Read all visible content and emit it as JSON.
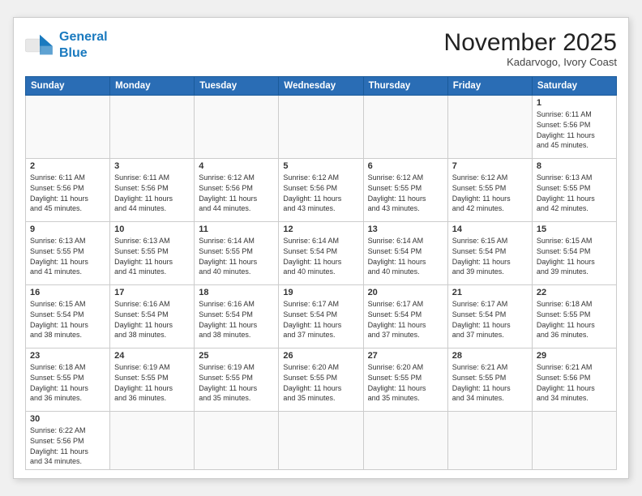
{
  "header": {
    "logo_line1": "General",
    "logo_line2": "Blue",
    "month_title": "November 2025",
    "location": "Kadarvogo, Ivory Coast"
  },
  "weekdays": [
    "Sunday",
    "Monday",
    "Tuesday",
    "Wednesday",
    "Thursday",
    "Friday",
    "Saturday"
  ],
  "days": [
    {
      "number": "",
      "info": ""
    },
    {
      "number": "",
      "info": ""
    },
    {
      "number": "",
      "info": ""
    },
    {
      "number": "",
      "info": ""
    },
    {
      "number": "",
      "info": ""
    },
    {
      "number": "",
      "info": ""
    },
    {
      "number": "1",
      "info": "Sunrise: 6:11 AM\nSunset: 5:56 PM\nDaylight: 11 hours\nand 45 minutes."
    },
    {
      "number": "2",
      "info": "Sunrise: 6:11 AM\nSunset: 5:56 PM\nDaylight: 11 hours\nand 45 minutes."
    },
    {
      "number": "3",
      "info": "Sunrise: 6:11 AM\nSunset: 5:56 PM\nDaylight: 11 hours\nand 44 minutes."
    },
    {
      "number": "4",
      "info": "Sunrise: 6:12 AM\nSunset: 5:56 PM\nDaylight: 11 hours\nand 44 minutes."
    },
    {
      "number": "5",
      "info": "Sunrise: 6:12 AM\nSunset: 5:56 PM\nDaylight: 11 hours\nand 43 minutes."
    },
    {
      "number": "6",
      "info": "Sunrise: 6:12 AM\nSunset: 5:55 PM\nDaylight: 11 hours\nand 43 minutes."
    },
    {
      "number": "7",
      "info": "Sunrise: 6:12 AM\nSunset: 5:55 PM\nDaylight: 11 hours\nand 42 minutes."
    },
    {
      "number": "8",
      "info": "Sunrise: 6:13 AM\nSunset: 5:55 PM\nDaylight: 11 hours\nand 42 minutes."
    },
    {
      "number": "9",
      "info": "Sunrise: 6:13 AM\nSunset: 5:55 PM\nDaylight: 11 hours\nand 41 minutes."
    },
    {
      "number": "10",
      "info": "Sunrise: 6:13 AM\nSunset: 5:55 PM\nDaylight: 11 hours\nand 41 minutes."
    },
    {
      "number": "11",
      "info": "Sunrise: 6:14 AM\nSunset: 5:55 PM\nDaylight: 11 hours\nand 40 minutes."
    },
    {
      "number": "12",
      "info": "Sunrise: 6:14 AM\nSunset: 5:54 PM\nDaylight: 11 hours\nand 40 minutes."
    },
    {
      "number": "13",
      "info": "Sunrise: 6:14 AM\nSunset: 5:54 PM\nDaylight: 11 hours\nand 40 minutes."
    },
    {
      "number": "14",
      "info": "Sunrise: 6:15 AM\nSunset: 5:54 PM\nDaylight: 11 hours\nand 39 minutes."
    },
    {
      "number": "15",
      "info": "Sunrise: 6:15 AM\nSunset: 5:54 PM\nDaylight: 11 hours\nand 39 minutes."
    },
    {
      "number": "16",
      "info": "Sunrise: 6:15 AM\nSunset: 5:54 PM\nDaylight: 11 hours\nand 38 minutes."
    },
    {
      "number": "17",
      "info": "Sunrise: 6:16 AM\nSunset: 5:54 PM\nDaylight: 11 hours\nand 38 minutes."
    },
    {
      "number": "18",
      "info": "Sunrise: 6:16 AM\nSunset: 5:54 PM\nDaylight: 11 hours\nand 38 minutes."
    },
    {
      "number": "19",
      "info": "Sunrise: 6:17 AM\nSunset: 5:54 PM\nDaylight: 11 hours\nand 37 minutes."
    },
    {
      "number": "20",
      "info": "Sunrise: 6:17 AM\nSunset: 5:54 PM\nDaylight: 11 hours\nand 37 minutes."
    },
    {
      "number": "21",
      "info": "Sunrise: 6:17 AM\nSunset: 5:54 PM\nDaylight: 11 hours\nand 37 minutes."
    },
    {
      "number": "22",
      "info": "Sunrise: 6:18 AM\nSunset: 5:55 PM\nDaylight: 11 hours\nand 36 minutes."
    },
    {
      "number": "23",
      "info": "Sunrise: 6:18 AM\nSunset: 5:55 PM\nDaylight: 11 hours\nand 36 minutes."
    },
    {
      "number": "24",
      "info": "Sunrise: 6:19 AM\nSunset: 5:55 PM\nDaylight: 11 hours\nand 36 minutes."
    },
    {
      "number": "25",
      "info": "Sunrise: 6:19 AM\nSunset: 5:55 PM\nDaylight: 11 hours\nand 35 minutes."
    },
    {
      "number": "26",
      "info": "Sunrise: 6:20 AM\nSunset: 5:55 PM\nDaylight: 11 hours\nand 35 minutes."
    },
    {
      "number": "27",
      "info": "Sunrise: 6:20 AM\nSunset: 5:55 PM\nDaylight: 11 hours\nand 35 minutes."
    },
    {
      "number": "28",
      "info": "Sunrise: 6:21 AM\nSunset: 5:55 PM\nDaylight: 11 hours\nand 34 minutes."
    },
    {
      "number": "29",
      "info": "Sunrise: 6:21 AM\nSunset: 5:56 PM\nDaylight: 11 hours\nand 34 minutes."
    },
    {
      "number": "30",
      "info": "Sunrise: 6:22 AM\nSunset: 5:56 PM\nDaylight: 11 hours\nand 34 minutes."
    },
    {
      "number": "",
      "info": ""
    },
    {
      "number": "",
      "info": ""
    },
    {
      "number": "",
      "info": ""
    },
    {
      "number": "",
      "info": ""
    },
    {
      "number": "",
      "info": ""
    },
    {
      "number": "",
      "info": ""
    }
  ]
}
